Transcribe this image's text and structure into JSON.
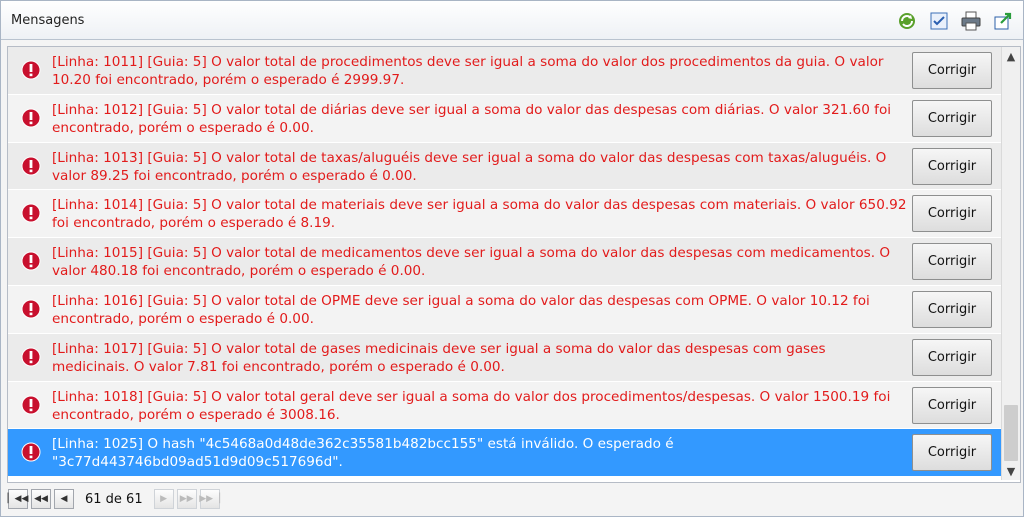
{
  "panel": {
    "title": "Mensagens"
  },
  "toolbar": {
    "icons": [
      "refresh-icon",
      "validate-icon",
      "print-icon",
      "export-icon"
    ]
  },
  "messages": [
    {
      "text": "[Linha: 1011] [Guia: 5] O valor total de procedimentos deve ser igual a soma do valor dos procedimentos da guia. O valor 10.20 foi encontrado, porém o esperado é 2999.97.",
      "button": "Corrigir"
    },
    {
      "text": "[Linha: 1012] [Guia: 5] O valor total de diárias deve ser igual a soma do valor das despesas com diárias. O valor 321.60 foi encontrado, porém o esperado é 0.00.",
      "button": "Corrigir"
    },
    {
      "text": "[Linha: 1013] [Guia: 5] O valor total de taxas/aluguéis deve ser igual a soma do valor das despesas com taxas/aluguéis. O valor 89.25 foi encontrado, porém o esperado é 0.00.",
      "button": "Corrigir"
    },
    {
      "text": "[Linha: 1014] [Guia: 5] O valor total de materiais deve ser igual a soma do valor das despesas com materiais. O valor 650.92 foi encontrado, porém o esperado é 8.19.",
      "button": "Corrigir"
    },
    {
      "text": "[Linha: 1015] [Guia: 5] O valor total de medicamentos deve ser igual a soma do valor das despesas com medicamentos. O valor 480.18 foi encontrado, porém o esperado é 0.00.",
      "button": "Corrigir"
    },
    {
      "text": "[Linha: 1016] [Guia: 5] O valor total de OPME deve ser igual a soma do valor das despesas com OPME. O valor 10.12 foi encontrado, porém o esperado é 0.00.",
      "button": "Corrigir"
    },
    {
      "text": "[Linha: 1017] [Guia: 5] O valor total de gases medicinais deve ser igual a soma do valor das despesas com gases medicinais. O valor 7.81 foi encontrado, porém o esperado é 0.00.",
      "button": "Corrigir"
    },
    {
      "text": "[Linha: 1018] [Guia: 5] O valor total geral deve ser igual a soma do valor dos procedimentos/despesas. O valor 1500.19 foi encontrado, porém o esperado é 3008.16.",
      "button": "Corrigir"
    },
    {
      "text": "[Linha: 1025] O hash \"4c5468a0d48de362c35581b482bcc155\" está inválido. O esperado é \"3c77d443746bd09ad51d9d09c517696d\".",
      "button": "Corrigir",
      "selected": true
    }
  ],
  "pager": {
    "info": "61 de 61"
  },
  "colors": {
    "error_text": "#e21b1b",
    "selected_row": "#3399ff",
    "error_icon": "#c8102e"
  }
}
